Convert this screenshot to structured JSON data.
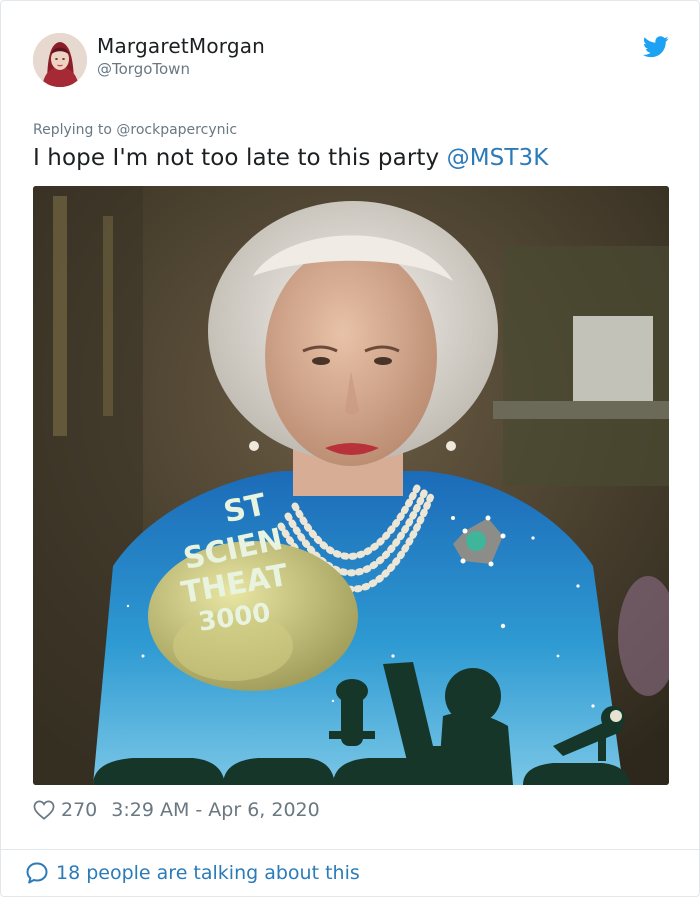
{
  "user": {
    "display_name": "MargaretMorgan",
    "handle": "@TorgoTown"
  },
  "tweet": {
    "replying_to_prefix": "Replying to ",
    "replying_to_handle": "@rockpapercynic",
    "text": "I hope I'm not too late to this party ",
    "mention": "@MST3K",
    "media_overlay_text": [
      "ST",
      "SCIEN",
      "THEAT",
      "3000"
    ]
  },
  "meta": {
    "like_count": "270",
    "timestamp": "3:29 AM - Apr 6, 2020"
  },
  "footer": {
    "talking_text": "18 people are talking about this"
  },
  "colors": {
    "link": "#2b7bb9",
    "twitter_blue": "#1da1f2",
    "secondary_text": "#697882",
    "primary_text": "#1c2022",
    "divider": "#e1e8ed"
  },
  "icons": {
    "brand": "twitter-bird-icon",
    "like": "heart-icon",
    "conversation": "speech-bubble-icon"
  }
}
